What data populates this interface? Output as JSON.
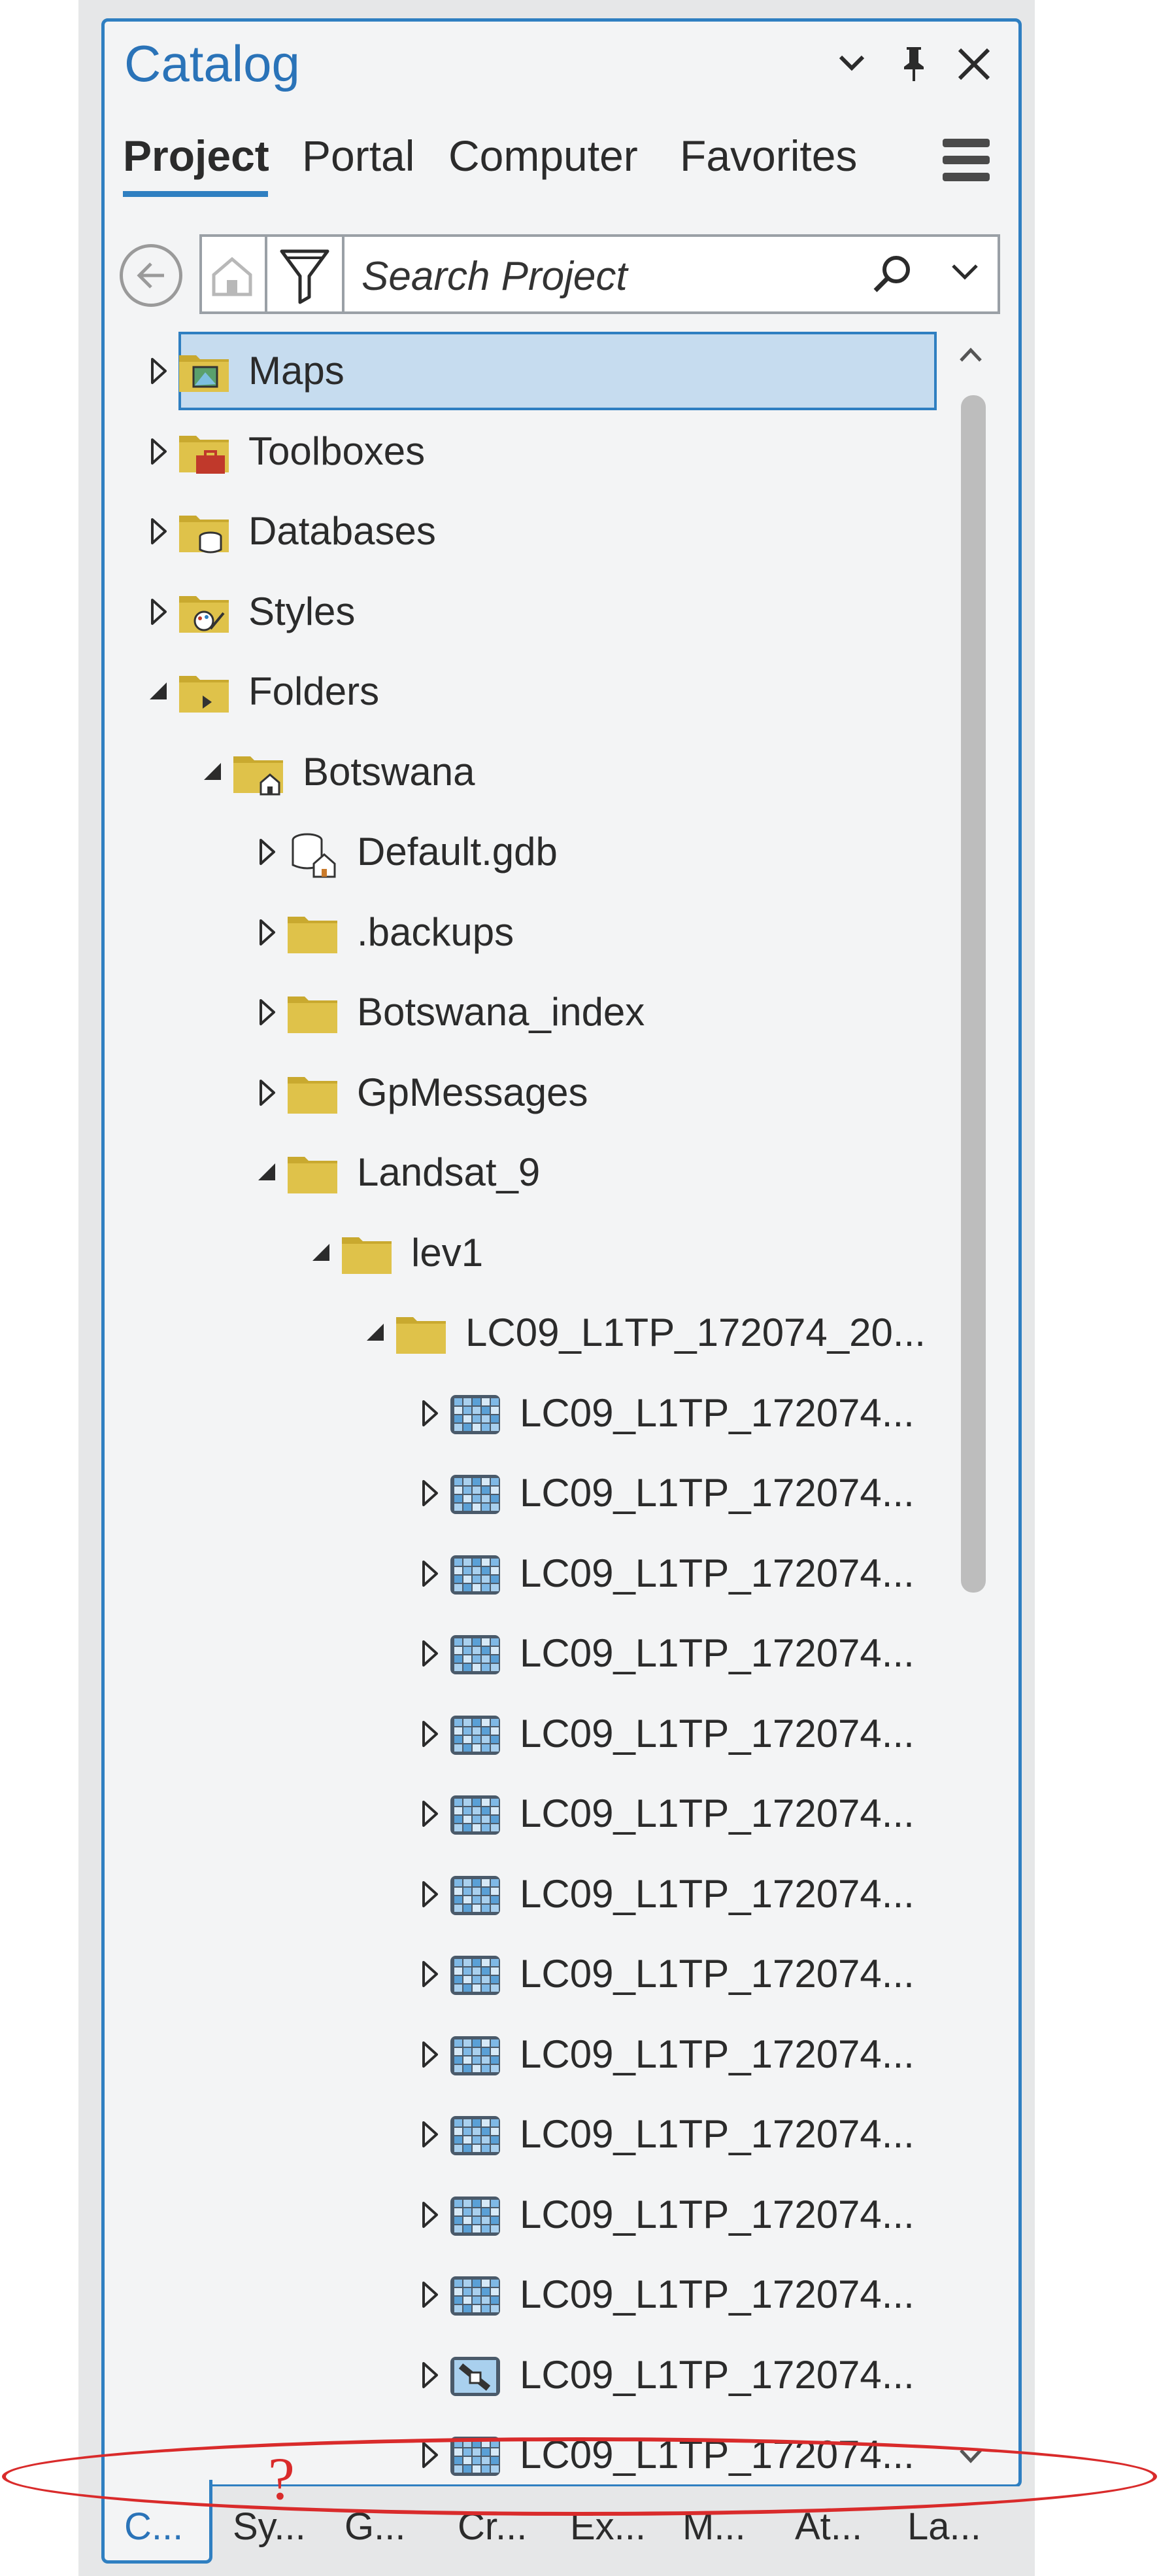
{
  "pane": {
    "title": "Catalog",
    "tabs": [
      "Project",
      "Portal",
      "Computer",
      "Favorites"
    ],
    "active_tab": "Project"
  },
  "search": {
    "placeholder": "Search Project"
  },
  "tree": [
    {
      "label": "Maps",
      "icon": "maps-folder-icon",
      "depth": 0,
      "state": "collapsed",
      "selected": true
    },
    {
      "label": "Toolboxes",
      "icon": "toolbox-folder-icon",
      "depth": 0,
      "state": "collapsed"
    },
    {
      "label": "Databases",
      "icon": "database-folder-icon",
      "depth": 0,
      "state": "collapsed"
    },
    {
      "label": "Styles",
      "icon": "styles-folder-icon",
      "depth": 0,
      "state": "collapsed"
    },
    {
      "label": "Folders",
      "icon": "folders-folder-icon",
      "depth": 0,
      "state": "expanded"
    },
    {
      "label": "Botswana",
      "icon": "home-folder-icon",
      "depth": 1,
      "state": "expanded"
    },
    {
      "label": "Default.gdb",
      "icon": "home-geodatabase-icon",
      "depth": 2,
      "state": "collapsed"
    },
    {
      "label": ".backups",
      "icon": "folder-icon",
      "depth": 2,
      "state": "collapsed"
    },
    {
      "label": "Botswana_index",
      "icon": "folder-icon",
      "depth": 2,
      "state": "collapsed"
    },
    {
      "label": "GpMessages",
      "icon": "folder-icon",
      "depth": 2,
      "state": "collapsed"
    },
    {
      "label": "Landsat_9",
      "icon": "folder-icon",
      "depth": 2,
      "state": "expanded"
    },
    {
      "label": "lev1",
      "icon": "folder-icon",
      "depth": 3,
      "state": "expanded"
    },
    {
      "label": "LC09_L1TP_172074_20...",
      "icon": "folder-icon",
      "depth": 4,
      "state": "expanded"
    },
    {
      "label": "LC09_L1TP_172074...",
      "icon": "raster-icon",
      "depth": 5,
      "state": "collapsed"
    },
    {
      "label": "LC09_L1TP_172074...",
      "icon": "raster-icon",
      "depth": 5,
      "state": "collapsed"
    },
    {
      "label": "LC09_L1TP_172074...",
      "icon": "raster-icon",
      "depth": 5,
      "state": "collapsed"
    },
    {
      "label": "LC09_L1TP_172074...",
      "icon": "raster-icon",
      "depth": 5,
      "state": "collapsed"
    },
    {
      "label": "LC09_L1TP_172074...",
      "icon": "raster-icon",
      "depth": 5,
      "state": "collapsed"
    },
    {
      "label": "LC09_L1TP_172074...",
      "icon": "raster-icon",
      "depth": 5,
      "state": "collapsed"
    },
    {
      "label": "LC09_L1TP_172074...",
      "icon": "raster-icon",
      "depth": 5,
      "state": "collapsed"
    },
    {
      "label": "LC09_L1TP_172074...",
      "icon": "raster-icon",
      "depth": 5,
      "state": "collapsed"
    },
    {
      "label": "LC09_L1TP_172074...",
      "icon": "raster-icon",
      "depth": 5,
      "state": "collapsed"
    },
    {
      "label": "LC09_L1TP_172074...",
      "icon": "raster-icon",
      "depth": 5,
      "state": "collapsed"
    },
    {
      "label": "LC09_L1TP_172074...",
      "icon": "raster-icon",
      "depth": 5,
      "state": "collapsed"
    },
    {
      "label": "LC09_L1TP_172074...",
      "icon": "raster-icon",
      "depth": 5,
      "state": "collapsed"
    },
    {
      "label": "LC09_L1TP_172074...",
      "icon": "satellite-raster-icon",
      "depth": 5,
      "state": "collapsed"
    },
    {
      "label": "LC09_L1TP_172074...",
      "icon": "raster-icon",
      "depth": 5,
      "state": "collapsed"
    }
  ],
  "bottom_tabs": [
    "C...",
    "Sy...",
    "G...",
    "Cr...",
    "Ex...",
    "M...",
    "At...",
    "La..."
  ],
  "annotation": {
    "mark": "?"
  },
  "colors": {
    "accent": "#2f7fc1",
    "selection": "#c6dcef",
    "folder": "#dfc24a",
    "annotation": "#d92b2b"
  }
}
